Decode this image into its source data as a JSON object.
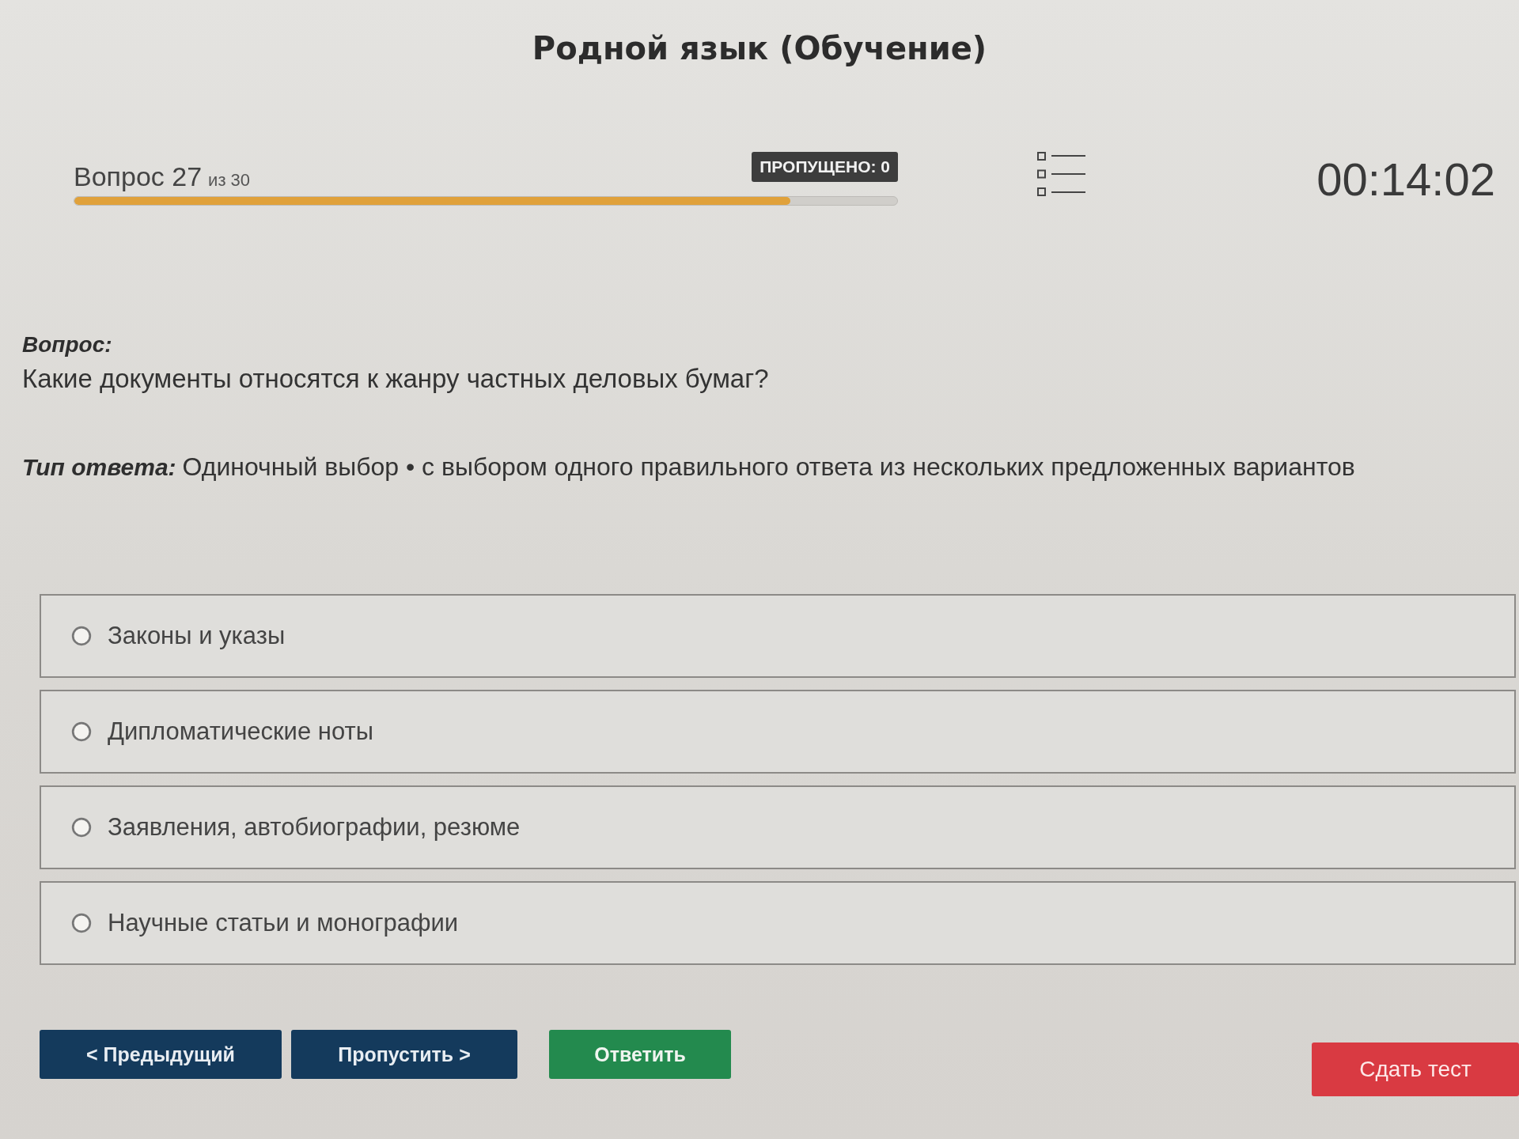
{
  "title": "Родной язык (Обучение)",
  "progress": {
    "label": "Вопрос 27",
    "total": "из 30",
    "level": 0.87,
    "skipped": "ПРОПУЩЕНО: 0",
    "timer": "00:14:02"
  },
  "question": {
    "label": "Вопрос:",
    "text": "Какие документы относятся к жанру частных деловых бумаг?",
    "answer_type_label": "Тип ответа:",
    "answer_type": "Одиночный выбор • с выбором одного правильного ответа из нескольких предложенных вариантов"
  },
  "options": [
    {
      "text": "Законы и указы",
      "selected": false
    },
    {
      "text": "Дипломатические ноты",
      "selected": false
    },
    {
      "text": "Заявления, автобиографии, резюме",
      "selected": false
    },
    {
      "text": "Научные статьи и монографии",
      "selected": false
    }
  ],
  "buttons": [
    {
      "kind": "nav",
      "label": "< Предыдущий"
    },
    {
      "kind": "nav",
      "label": "Пропустить >"
    },
    {
      "kind": "answer",
      "label": "Ответить"
    },
    {
      "kind": "finish",
      "label": "Сдать тест"
    }
  ]
}
